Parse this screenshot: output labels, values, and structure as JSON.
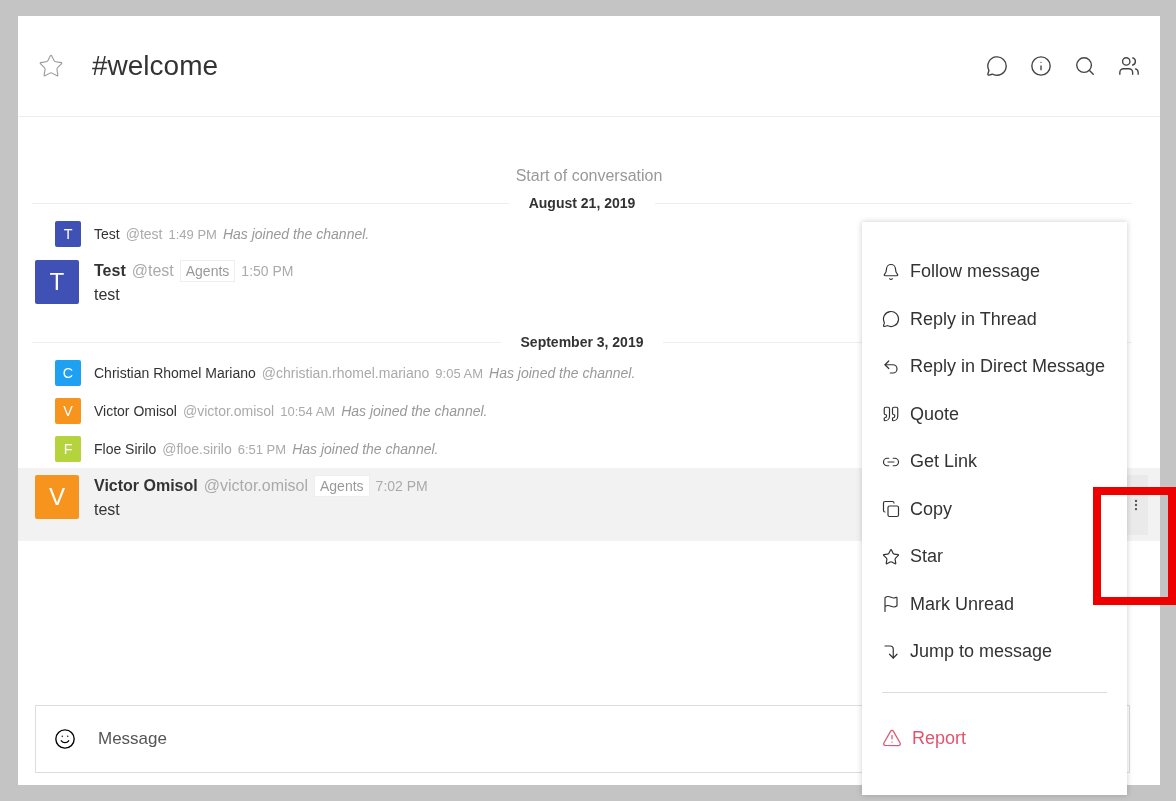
{
  "channel": {
    "name": "#welcome",
    "starred": false
  },
  "start_text": "Start of conversation",
  "groups": [
    {
      "date": "August 21, 2019",
      "messages": [
        {
          "kind": "system",
          "avatar": "T",
          "color": "#3f51b5",
          "name": "Test",
          "username": "@test",
          "time": "1:49 PM",
          "text": "Has joined the channel.",
          "hovered": false
        },
        {
          "kind": "message",
          "avatar": "T",
          "color": "#3f51b5",
          "name": "Test",
          "username": "@test",
          "role": "Agents",
          "time": "1:50 PM",
          "text": "test",
          "hovered": false
        }
      ]
    },
    {
      "date": "September 3, 2019",
      "messages": [
        {
          "kind": "system",
          "avatar": "C",
          "color": "#1ea1f2",
          "name": "Christian Rhomel Mariano",
          "username": "@christian.rhomel.mariano",
          "time": "9:05 AM",
          "text": "Has joined the channel.",
          "hovered": false
        },
        {
          "kind": "system",
          "avatar": "V",
          "color": "#f7941d",
          "name": "Victor Omisol",
          "username": "@victor.omisol",
          "time": "10:54 AM",
          "text": "Has joined the channel.",
          "hovered": false
        },
        {
          "kind": "system",
          "avatar": "F",
          "color": "#b5d33d",
          "name": "Floe Sirilo",
          "username": "@floe.sirilo",
          "time": "6:51 PM",
          "text": "Has joined the channel.",
          "hovered": false
        },
        {
          "kind": "message",
          "avatar": "V",
          "color": "#f7941d",
          "name": "Victor Omisol",
          "username": "@victor.omisol",
          "role": "Agents",
          "time": "7:02 PM",
          "text": "test",
          "hovered": true
        }
      ]
    }
  ],
  "menu": [
    {
      "label": "Follow message",
      "kind": "normal"
    },
    {
      "label": "Reply in Thread",
      "kind": "normal"
    },
    {
      "label": "Reply in Direct Message",
      "kind": "normal"
    },
    {
      "label": "Quote",
      "kind": "normal"
    },
    {
      "label": "Get Link",
      "kind": "normal"
    },
    {
      "label": "Copy",
      "kind": "normal"
    },
    {
      "label": "Star",
      "kind": "normal"
    },
    {
      "label": "Mark Unread",
      "kind": "normal"
    },
    {
      "label": "Jump to message",
      "kind": "normal"
    },
    {
      "label": "Report",
      "kind": "danger"
    }
  ],
  "composer": {
    "placeholder": "Message"
  }
}
